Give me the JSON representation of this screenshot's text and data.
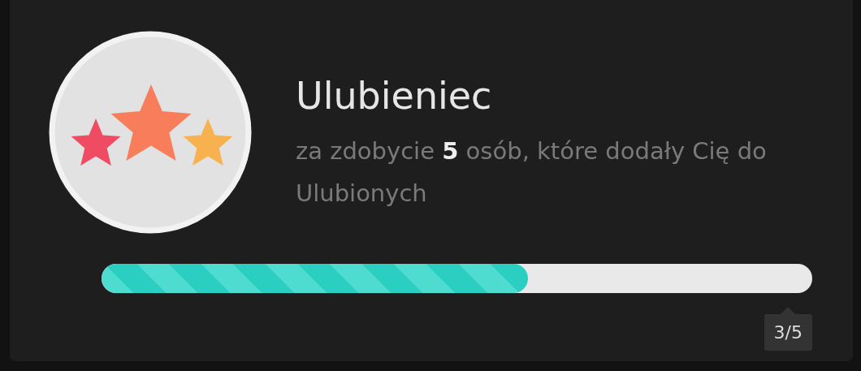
{
  "achievement": {
    "title": "Ulubieniec",
    "description": "za zdobycie **5** osób, które dodały Cię do Ulubionych",
    "progress": {
      "level": 0.6,
      "reading": "3/5"
    }
  }
}
